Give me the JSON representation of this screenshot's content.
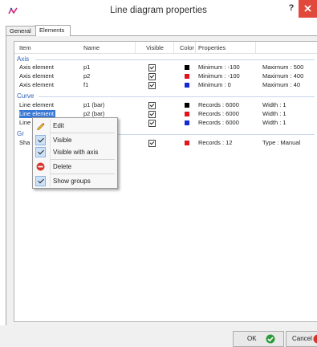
{
  "window": {
    "title": "Line diagram properties",
    "help_label": "?",
    "close_label": "✕"
  },
  "tabs": [
    {
      "label": "General"
    },
    {
      "label": "Elements"
    }
  ],
  "columns": {
    "item": "Item",
    "name": "Name",
    "visible": "Visible",
    "color": "Color",
    "properties": "Properties"
  },
  "groups": {
    "axis": "Axis",
    "curve": "Curve",
    "group": "Gr"
  },
  "axis_rows": [
    {
      "item": "Axis element",
      "name": "p1",
      "color": "#000000",
      "prop1": "Minimum : -100",
      "prop2": "Maximum : 500"
    },
    {
      "item": "Axis element",
      "name": "p2",
      "color": "#e0151b",
      "prop1": "Minimum : -100",
      "prop2": "Maximum : 400"
    },
    {
      "item": "Axis element",
      "name": "f1",
      "color": "#1229d8",
      "prop1": "Minimum : 0",
      "prop2": "Maximum : 40"
    }
  ],
  "curve_rows": [
    {
      "item": "Line element",
      "name": "p1 (bar)",
      "color": "#000000",
      "prop1": "Records : 6000",
      "prop2": "Width : 1"
    },
    {
      "item": "Line element",
      "name": "p2 (bar)",
      "color": "#e0151b",
      "prop1": "Records : 6000",
      "prop2": "Width : 1"
    },
    {
      "item": "Line",
      "name": "",
      "color": "#1229d8",
      "prop1": "Records : 6000",
      "prop2": "Width : 1"
    }
  ],
  "group_rows": [
    {
      "item": "Sha",
      "name": "",
      "color": "#e0151b",
      "prop1": "Records : 12",
      "prop2": "Type : Manual"
    }
  ],
  "context_menu": {
    "edit": "Edit",
    "visible": "Visible",
    "visible_with_axis": "Visible with axis",
    "delete": "Delete",
    "show_groups": "Show groups"
  },
  "buttons": {
    "ok": "OK",
    "cancel": "Cancel"
  }
}
